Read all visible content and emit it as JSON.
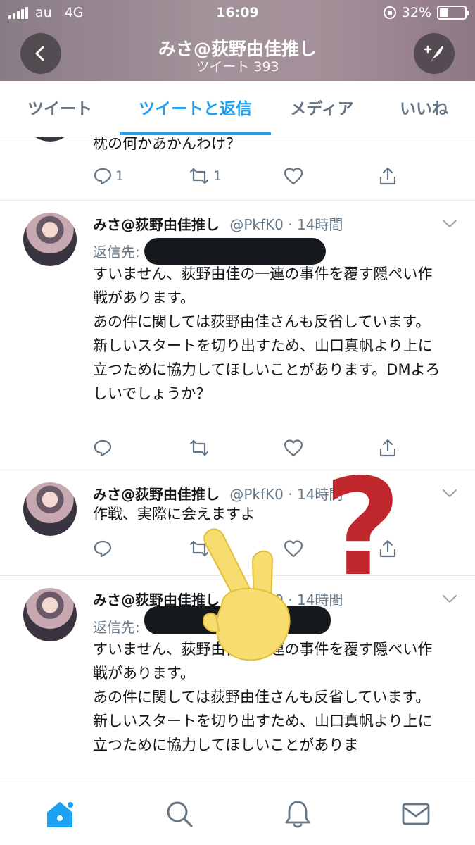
{
  "status_bar": {
    "carrier": "au",
    "network": "4G",
    "time": "16:09",
    "battery_percent": "32%",
    "battery_level": 0.32
  },
  "header": {
    "title": "みさ@荻野由佳推し",
    "subtitle": "ツイート 393",
    "back_icon": "chevron-left-icon",
    "compose_icon": "compose-tweet-icon"
  },
  "tabs": [
    {
      "label": "ツイート",
      "active": false
    },
    {
      "label": "ツイートと返信",
      "active": true
    },
    {
      "label": "メディア",
      "active": false
    },
    {
      "label": "いいね",
      "active": false
    }
  ],
  "tweets": [
    {
      "partial": true,
      "text": "枕の何かあかんわけ？",
      "reply_count": "1",
      "retweet_count": "1"
    },
    {
      "name": "みさ@荻野由佳推し",
      "handle": "@PkfK0",
      "time": "· 14時間",
      "reply_to_label": "返信先:",
      "text": "すいません、荻野由佳の一連の事件を覆す隠ぺい作戦があります。\nあの件に関しては荻野由佳さんも反省しています。\n新しいスタートを切り出すため、山口真帆より上に立つために協力してほしいことがあります。DMよろしいでしょうか？"
    },
    {
      "name": "みさ@荻野由佳推し",
      "handle": "@PkfK0",
      "time": "· 14時間",
      "text": "作戦、実際に会えますよ"
    },
    {
      "name": "みさ@荻野由佳推し",
      "handle": "@PkfK0",
      "time": "· 14時間",
      "reply_to_label": "返信先:",
      "text": "すいません、荻野由佳の一連の事件を覆す隠ぺい作戦があります。\nあの件に関しては荻野由佳さんも反省しています。\n新しいスタートを切り出すため、山口真帆より上に立つために協力してほしいことがありま"
    }
  ],
  "icons": {
    "reply": "reply-icon",
    "retweet": "retweet-icon",
    "like": "heart-icon",
    "share": "share-icon",
    "caret": "chevron-down-icon"
  },
  "overlays": {
    "question_mark": "?",
    "question_color": "#c0272d",
    "peace_hand_color": "#f7dc6f"
  },
  "bottom_nav": [
    {
      "icon": "home-icon",
      "active": true
    },
    {
      "icon": "search-icon",
      "active": false
    },
    {
      "icon": "notifications-icon",
      "active": false
    },
    {
      "icon": "messages-icon",
      "active": false
    }
  ],
  "colors": {
    "accent": "#1da1f2",
    "muted": "#657786",
    "text": "#14171a"
  }
}
